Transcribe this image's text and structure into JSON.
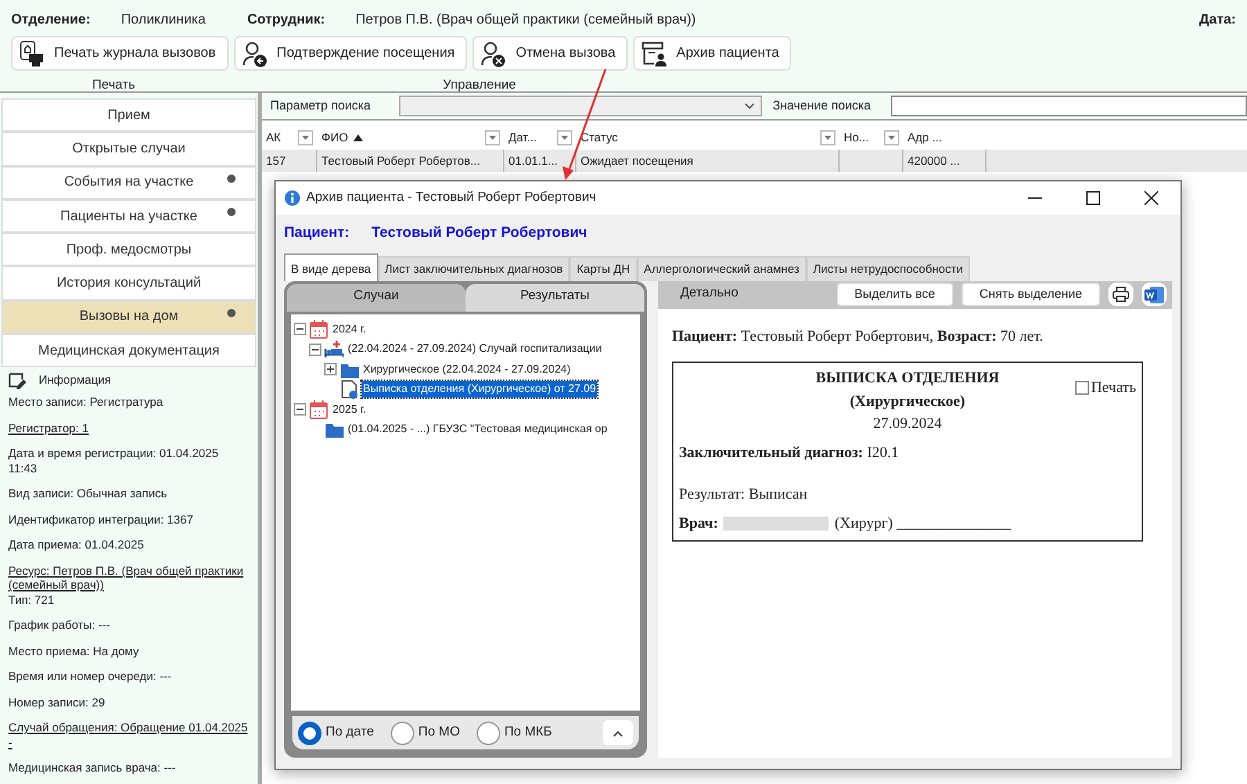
{
  "header": {
    "fields": [
      {
        "label": "Отделение:",
        "value": "Поликлиника"
      },
      {
        "label": "Сотрудник:",
        "value": "Петров П.В. (Врач общей практики (семейный врач))"
      }
    ],
    "date_label": "Дата:"
  },
  "toolbar": {
    "buttons": [
      {
        "kind": "print",
        "label": "Печать журнала вызовов"
      },
      {
        "kind": "confirm",
        "label": "Подтверждение посещения"
      },
      {
        "kind": "cancel",
        "label": "Отмена вызова"
      },
      {
        "kind": "archive",
        "label": "Архив пациента"
      }
    ],
    "groups": [
      "Печать",
      "Управление"
    ]
  },
  "sidebar": {
    "items": [
      {
        "label": "Прием",
        "selected": false,
        "indicator": false
      },
      {
        "label": "Открытые случаи",
        "selected": false,
        "indicator": false
      },
      {
        "label": "События на участке",
        "selected": false,
        "indicator": true
      },
      {
        "label": "Пациенты на участке",
        "selected": false,
        "indicator": true
      },
      {
        "label": "Проф. медосмотры",
        "selected": false,
        "indicator": false
      },
      {
        "label": "История консультаций",
        "selected": false,
        "indicator": false
      },
      {
        "label": "Вызовы на дом",
        "selected": true,
        "indicator": true
      },
      {
        "label": "Медицинская документация",
        "selected": false,
        "indicator": false
      }
    ]
  },
  "info": {
    "title": "Информация",
    "lines": [
      {
        "text": "Место записи: Регистратура",
        "link": false
      },
      {
        "text": "Регистратор: 1",
        "link": true
      },
      {
        "text": "Дата и время регистрации: 01.04.2025 11:43",
        "link": false
      },
      {
        "text": "Вид записи: Обычная запись",
        "link": false
      },
      {
        "text": "Идентификатор интеграции: 1367",
        "link": false
      },
      {
        "text": "Дата приема: 01.04.2025",
        "link": false
      },
      {
        "text": "Ресурс: Петров П.В. (Врач общей практики (семейный врач))",
        "link": true,
        "sub": "Тип: 721"
      },
      {
        "text": "График работы: ---",
        "link": false
      },
      {
        "text": "Место приема: На дому",
        "link": false
      },
      {
        "text": "Время или номер очереди: ---",
        "link": false
      },
      {
        "text": "Номер записи: 29",
        "link": false
      },
      {
        "text": "Случай обращения: Обращение 01.04.2025 -",
        "link": true
      },
      {
        "text": "Медицинская запись врача: ---",
        "link": false
      }
    ]
  },
  "search": {
    "parameter_label": "Параметр поиска",
    "value_label": "Значение поиска"
  },
  "table": {
    "columns": [
      {
        "label": "АК",
        "sorted": false
      },
      {
        "label": "ФИО",
        "sorted": true
      },
      {
        "label": "Дат...",
        "sorted": false
      },
      {
        "label": "Статус",
        "sorted": false
      },
      {
        "label": "Но...",
        "sorted": false
      },
      {
        "label": "Адр ...",
        "sorted": false
      }
    ],
    "rows": [
      {
        "cells": [
          "157",
          "Тестовый  Роберт  Робертов...",
          "01.01.1...",
          "Ожидает посещения",
          null,
          "420000 ..."
        ]
      }
    ]
  },
  "dialog": {
    "title": "Архив пациента - Тестовый Роберт Робертович",
    "patient_label": "Пациент:",
    "patient_name": "Тестовый Роберт Робертович",
    "tabs": [
      {
        "label": "В виде дерева",
        "selected": true
      },
      {
        "label": "Лист заключительных диагнозов",
        "selected": false
      },
      {
        "label": "Карты ДН",
        "selected": false
      },
      {
        "label": "Аллергологический анамнез",
        "selected": false
      },
      {
        "label": "Листы нетрудоспособности",
        "selected": false
      }
    ],
    "left_tabs": [
      {
        "label": "Случаи",
        "selected": true
      },
      {
        "label": "Результаты",
        "selected": false
      }
    ],
    "tree": [
      {
        "kind": "year",
        "label": "2024 г.",
        "expanded": true,
        "selected": false,
        "children": [
          {
            "kind": "hospitalization",
            "label": "(22.04.2024 - 27.09.2024) Случай госпитализации",
            "expanded": true,
            "selected": false,
            "children": [
              {
                "kind": "department",
                "label": "Хирургическое (22.04.2024 - 27.09.2024)",
                "expanded": false,
                "selected": false
              },
              {
                "kind": "document",
                "label": "Выписка отделения (Хирургическое) от 27.09",
                "selected": true
              }
            ]
          }
        ]
      },
      {
        "kind": "year",
        "label": "2025 г.",
        "expanded": true,
        "selected": false,
        "children": [
          {
            "kind": "case",
            "label": "(01.04.2025 - ...) ГБУЗС \"Тестовая медицинская ор",
            "selected": false
          }
        ]
      }
    ],
    "sort_options": [
      {
        "label": "По дате",
        "selected": true
      },
      {
        "label": "По МО",
        "selected": false
      },
      {
        "label": "По МКБ",
        "selected": false
      }
    ],
    "detail": {
      "heading": "Детально",
      "buttons": [
        "Выделить все",
        "Снять выделение"
      ],
      "patient_line": "**Пациент:** Тестовый Роберт Робертович, **Возраст:** 70 лет.",
      "document": {
        "title": "ВЫПИСКА ОТДЕЛЕНИЯ",
        "subtitle": "(Хирургическое)",
        "date": "27.09.2024",
        "print": {
          "label": "Печать",
          "checked": false
        },
        "diagnosis": "**Заключительный диагноз:** I20.1",
        "result": "Результат: Выписан",
        "doctor_label": "Врач:",
        "doctor_role": "(Хирург) _______________"
      }
    }
  }
}
